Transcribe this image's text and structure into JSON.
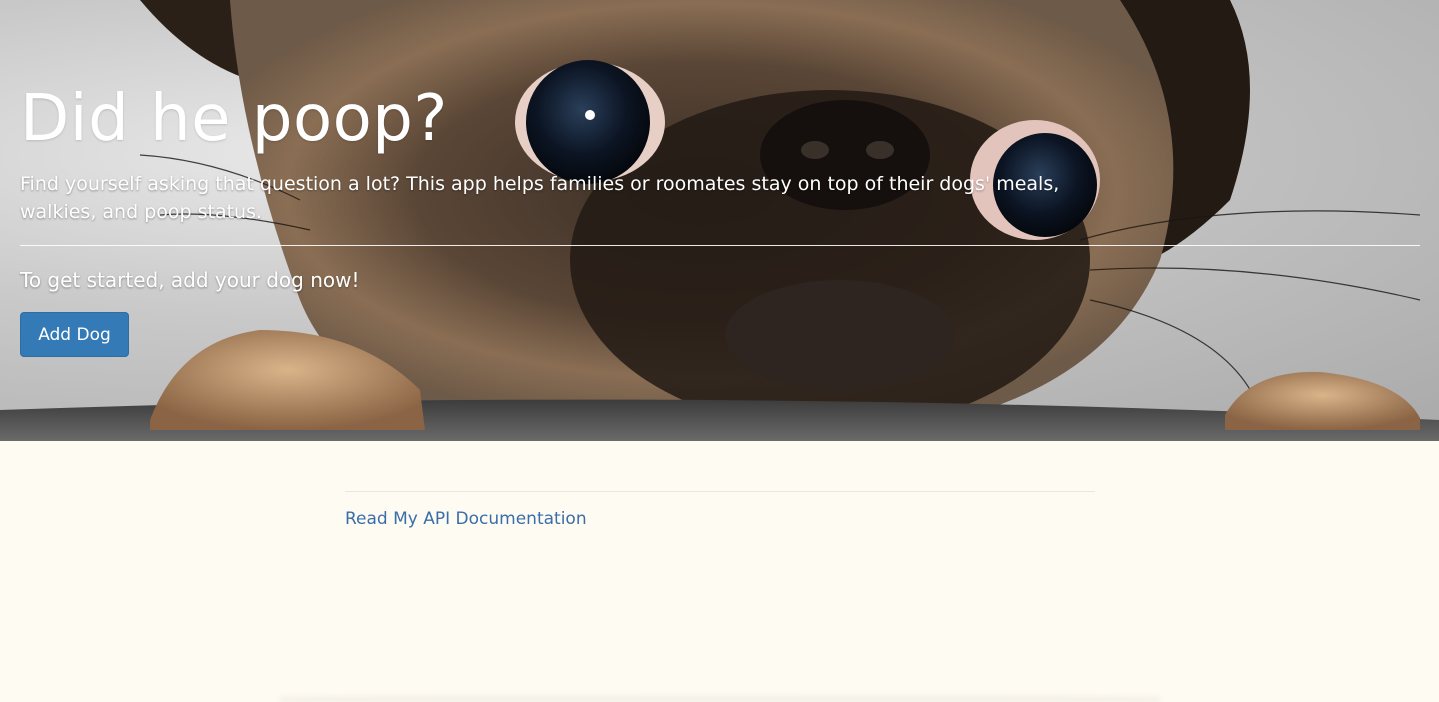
{
  "hero": {
    "title": "Did he poop?",
    "description": "Find yourself asking that question a lot? This app helps families or roomates stay on top of their dogs' meals, walkies, and poop status.",
    "cta_text": "To get started, add your dog now!",
    "add_dog_label": "Add Dog",
    "image": "pug-face-photo"
  },
  "content": {
    "api_doc_label": "Read My API Documentation"
  },
  "colors": {
    "primary_button": "#337ab7",
    "link": "#3a6ea8",
    "page_background": "#fefbf3"
  }
}
